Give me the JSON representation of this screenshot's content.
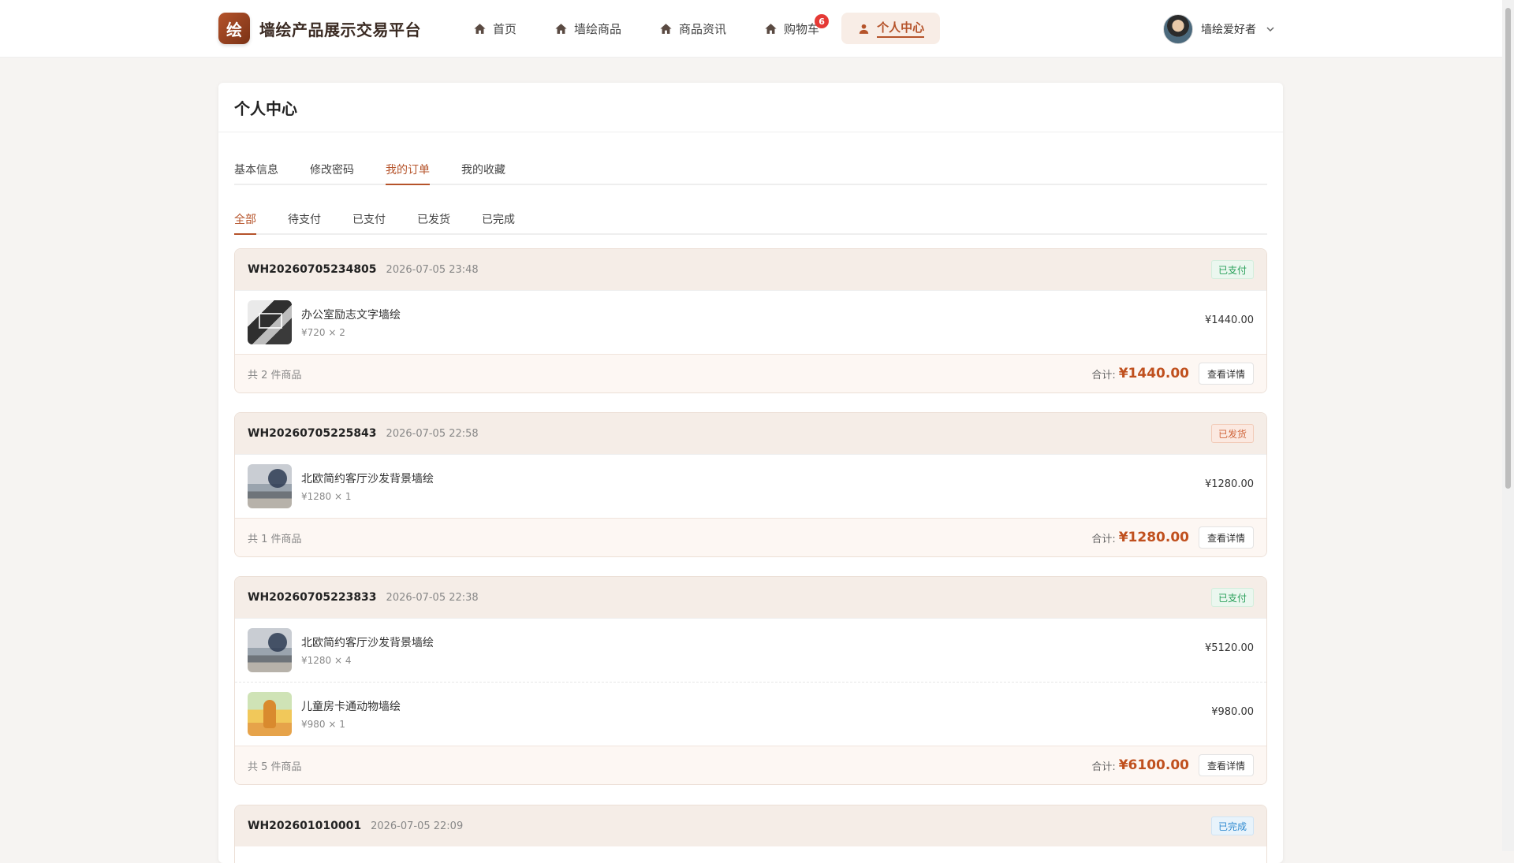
{
  "brand": {
    "logo_char": "绘",
    "title": "墙绘产品展示交易平台"
  },
  "nav": [
    {
      "label": "首页",
      "icon": "home-icon",
      "active": false
    },
    {
      "label": "墙绘商品",
      "icon": "home-icon",
      "active": false
    },
    {
      "label": "商品资讯",
      "icon": "home-icon",
      "active": false
    },
    {
      "label": "购物车",
      "icon": "home-icon",
      "active": false,
      "badge": "6"
    },
    {
      "label": "个人中心",
      "icon": "user-icon",
      "active": true
    }
  ],
  "user": {
    "name": "墙绘爱好者"
  },
  "panel": {
    "title": "个人中心"
  },
  "tabs": [
    "基本信息",
    "修改密码",
    "我的订单",
    "我的收藏"
  ],
  "active_tab": "我的订单",
  "subtabs": [
    "全部",
    "待支付",
    "已支付",
    "已发货",
    "已完成"
  ],
  "active_subtab": "全部",
  "orders": [
    {
      "order_no": "WH20260705234805",
      "time": "2026-07-05 23:48",
      "status": "已支付",
      "items": [
        {
          "name": "办公室励志文字墙绘",
          "sub": "¥720 × 2",
          "price": "¥1440.00"
        }
      ],
      "count": "共 2 件商品",
      "total_label": "合计:",
      "total": "¥1440.00",
      "detail_label": "查看详情"
    },
    {
      "order_no": "WH20260705225843",
      "time": "2026-07-05 22:58",
      "status": "已发货",
      "items": [
        {
          "name": "北欧简约客厅沙发背景墙绘",
          "sub": "¥1280 × 1",
          "price": "¥1280.00"
        }
      ],
      "count": "共 1 件商品",
      "total_label": "合计:",
      "total": "¥1280.00",
      "detail_label": "查看详情"
    },
    {
      "order_no": "WH20260705223833",
      "time": "2026-07-05 22:38",
      "status": "已支付",
      "items": [
        {
          "name": "北欧简约客厅沙发背景墙绘",
          "sub": "¥1280 × 4",
          "price": "¥5120.00"
        },
        {
          "name": "儿童房卡通动物墙绘",
          "sub": "¥980 × 1",
          "price": "¥980.00"
        }
      ],
      "count": "共 5 件商品",
      "total_label": "合计:",
      "total": "¥6100.00",
      "detail_label": "查看详情"
    },
    {
      "order_no": "WH202601010001",
      "time": "2026-07-05 22:09",
      "status": "已完成",
      "items": [],
      "count": "",
      "total_label": "",
      "total": "",
      "detail_label": ""
    }
  ],
  "colors": {
    "accent": "#b5532a",
    "header_bg": "#ffffff",
    "page_bg": "#f6f4f2"
  }
}
